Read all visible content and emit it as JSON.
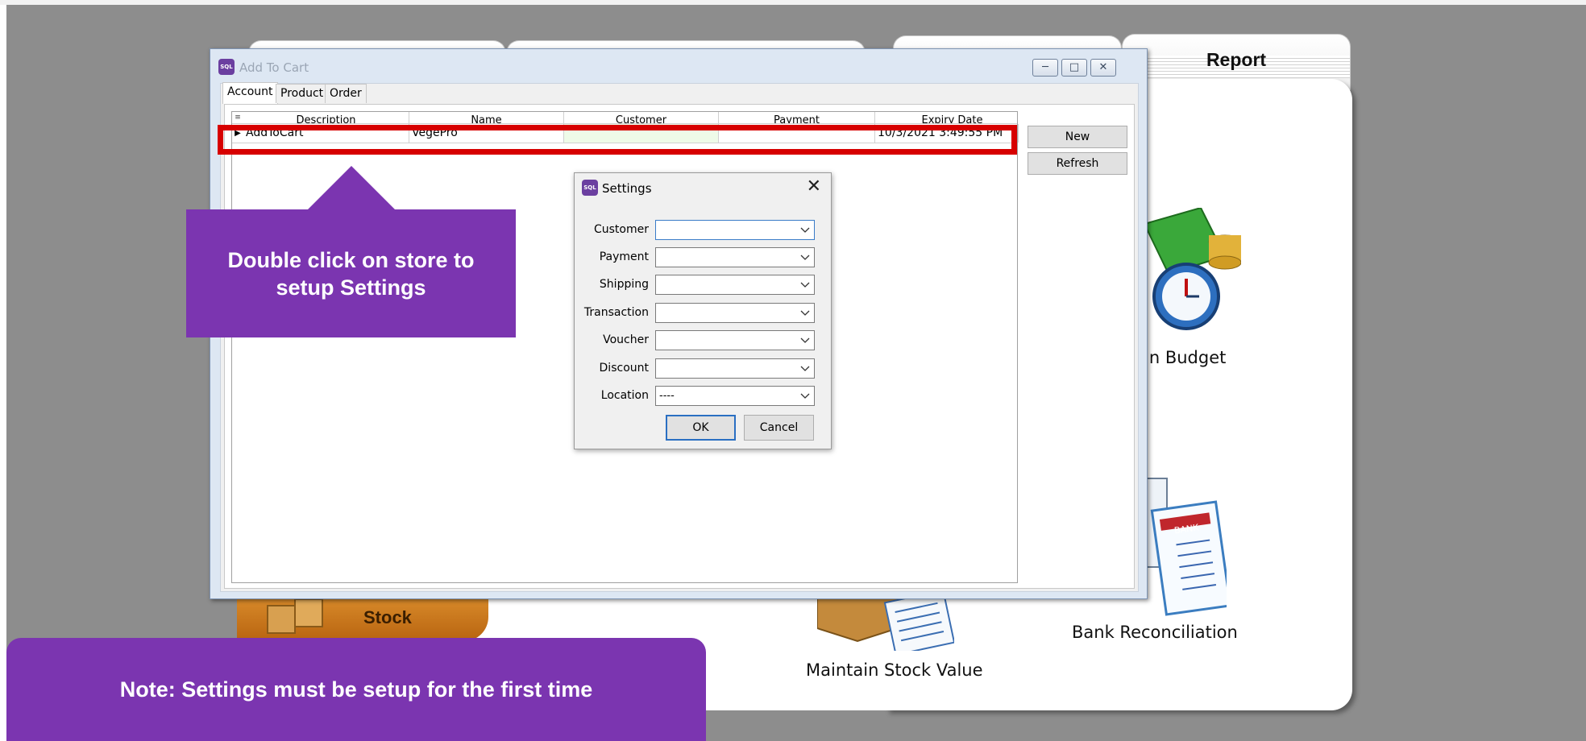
{
  "background": {
    "report_tab": "Report",
    "labels": {
      "budget": "in Budget",
      "bank_reconciliation": "Bank Reconciliation",
      "maintain_stock_value": "Maintain Stock Value",
      "stock": "Stock"
    },
    "bank_sign": "BANK"
  },
  "window": {
    "title": "Add To Cart",
    "icon_text": "SQL",
    "tabs": [
      {
        "label": "Account",
        "active": true
      },
      {
        "label": "Product",
        "active": false
      },
      {
        "label": "Order",
        "active": false
      }
    ],
    "grid": {
      "columns": [
        "Description",
        "Name",
        "Customer",
        "Payment",
        "Expiry Date"
      ],
      "rows": [
        {
          "description": "AddToCart",
          "name": "VegePro",
          "customer": "",
          "payment": "",
          "expiry_date": "10/3/2021 3:49:55 PM"
        }
      ]
    },
    "buttons": {
      "new": "New",
      "refresh": "Refresh"
    }
  },
  "settings_dialog": {
    "title": "Settings",
    "icon_text": "SQL",
    "fields": [
      {
        "label": "Customer",
        "value": ""
      },
      {
        "label": "Payment",
        "value": ""
      },
      {
        "label": "Shipping",
        "value": ""
      },
      {
        "label": "Transaction",
        "value": ""
      },
      {
        "label": "Voucher",
        "value": ""
      },
      {
        "label": "Discount",
        "value": ""
      },
      {
        "label": "Location",
        "value": "----"
      }
    ],
    "ok_label": "OK",
    "cancel_label": "Cancel"
  },
  "callouts": {
    "double_click": "Double click on store to setup Settings",
    "note": "Note: Settings must be setup for the first time"
  },
  "colors": {
    "callout": "#7b35b0",
    "highlight": "#d70000"
  }
}
